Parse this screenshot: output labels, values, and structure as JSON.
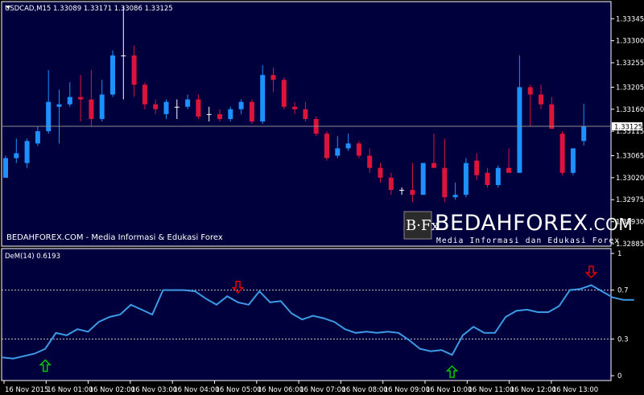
{
  "colors": {
    "background": "#000000",
    "panel": "#00003c",
    "frame": "#ffffff",
    "bull": "#1e90ff",
    "bear": "#dc143c",
    "doji": "#ffffff",
    "indicator_line": "#3c9be6",
    "up_arrow": "#00c800",
    "down_arrow": "#e60000"
  },
  "chart_data": [
    {
      "type": "candlestick",
      "title": "USDCAD,M15  1.33089 1.33171 1.33086 1.33125",
      "symbol": "USDCAD,M15",
      "ohlc_header": "1.33089 1.33171 1.33086 1.33125",
      "ylim": [
        1.3288,
        1.3338
      ],
      "yticks": [
        "1.33345",
        "1.33300",
        "1.33255",
        "1.33205",
        "1.33160",
        "1.33115",
        "1.33065",
        "1.33020",
        "1.32975",
        "1.32930",
        "1.32885"
      ],
      "ytick_values": [
        1.33345,
        1.333,
        1.33255,
        1.33205,
        1.3316,
        1.33115,
        1.33065,
        1.3302,
        1.32975,
        1.3293,
        1.32885
      ],
      "current_price_label": "1.33125",
      "current_price": 1.33125,
      "candles": [
        {
          "o": 1.3302,
          "h": 1.33065,
          "l": 1.3302,
          "c": 1.3306
        },
        {
          "o": 1.3306,
          "h": 1.331,
          "l": 1.3305,
          "c": 1.3307
        },
        {
          "o": 1.3305,
          "h": 1.331,
          "l": 1.3304,
          "c": 1.33095
        },
        {
          "o": 1.3309,
          "h": 1.33125,
          "l": 1.33085,
          "c": 1.33115
        },
        {
          "o": 1.33115,
          "h": 1.3324,
          "l": 1.3311,
          "c": 1.33175
        },
        {
          "o": 1.33165,
          "h": 1.332,
          "l": 1.3309,
          "c": 1.3317
        },
        {
          "o": 1.3317,
          "h": 1.33215,
          "l": 1.33165,
          "c": 1.33185
        },
        {
          "o": 1.33185,
          "h": 1.3323,
          "l": 1.33135,
          "c": 1.3318
        },
        {
          "o": 1.3318,
          "h": 1.3324,
          "l": 1.33125,
          "c": 1.3314
        },
        {
          "o": 1.3314,
          "h": 1.3322,
          "l": 1.33135,
          "c": 1.3319
        },
        {
          "o": 1.3319,
          "h": 1.3328,
          "l": 1.33185,
          "c": 1.3327
        },
        {
          "o": 1.3327,
          "h": 1.3337,
          "l": 1.3318,
          "c": 1.3327
        },
        {
          "o": 1.3327,
          "h": 1.3329,
          "l": 1.33185,
          "c": 1.3321
        },
        {
          "o": 1.3321,
          "h": 1.33215,
          "l": 1.3316,
          "c": 1.3317
        },
        {
          "o": 1.3317,
          "h": 1.3318,
          "l": 1.3315,
          "c": 1.3316
        },
        {
          "o": 1.3315,
          "h": 1.3318,
          "l": 1.3314,
          "c": 1.33175
        },
        {
          "o": 1.33165,
          "h": 1.3318,
          "l": 1.3314,
          "c": 1.33165
        },
        {
          "o": 1.33165,
          "h": 1.3319,
          "l": 1.3316,
          "c": 1.3318
        },
        {
          "o": 1.3318,
          "h": 1.3319,
          "l": 1.3314,
          "c": 1.33145
        },
        {
          "o": 1.3315,
          "h": 1.33165,
          "l": 1.33135,
          "c": 1.3315
        },
        {
          "o": 1.3315,
          "h": 1.3316,
          "l": 1.33135,
          "c": 1.3314
        },
        {
          "o": 1.3314,
          "h": 1.33165,
          "l": 1.33135,
          "c": 1.3316
        },
        {
          "o": 1.3316,
          "h": 1.3318,
          "l": 1.3315,
          "c": 1.33175
        },
        {
          "o": 1.33175,
          "h": 1.3318,
          "l": 1.3313,
          "c": 1.33135
        },
        {
          "o": 1.33135,
          "h": 1.3325,
          "l": 1.3313,
          "c": 1.3323
        },
        {
          "o": 1.3323,
          "h": 1.33245,
          "l": 1.33195,
          "c": 1.3322
        },
        {
          "o": 1.3322,
          "h": 1.33225,
          "l": 1.3316,
          "c": 1.33165
        },
        {
          "o": 1.33165,
          "h": 1.33175,
          "l": 1.3315,
          "c": 1.3316
        },
        {
          "o": 1.3316,
          "h": 1.33175,
          "l": 1.33135,
          "c": 1.3314
        },
        {
          "o": 1.3314,
          "h": 1.33145,
          "l": 1.33105,
          "c": 1.3311
        },
        {
          "o": 1.3311,
          "h": 1.33115,
          "l": 1.33055,
          "c": 1.3306
        },
        {
          "o": 1.33065,
          "h": 1.33105,
          "l": 1.3306,
          "c": 1.3308
        },
        {
          "o": 1.3308,
          "h": 1.3311,
          "l": 1.33075,
          "c": 1.3309
        },
        {
          "o": 1.3309,
          "h": 1.33095,
          "l": 1.3306,
          "c": 1.33065
        },
        {
          "o": 1.33065,
          "h": 1.3308,
          "l": 1.3303,
          "c": 1.3304
        },
        {
          "o": 1.3304,
          "h": 1.3305,
          "l": 1.3301,
          "c": 1.3302
        },
        {
          "o": 1.3302,
          "h": 1.3303,
          "l": 1.32985,
          "c": 1.32995
        },
        {
          "o": 1.32995,
          "h": 1.33,
          "l": 1.32985,
          "c": 1.32995
        },
        {
          "o": 1.32995,
          "h": 1.3305,
          "l": 1.3297,
          "c": 1.32985
        },
        {
          "o": 1.32985,
          "h": 1.3305,
          "l": 1.32985,
          "c": 1.3305
        },
        {
          "o": 1.3305,
          "h": 1.3311,
          "l": 1.3304,
          "c": 1.3304
        },
        {
          "o": 1.3304,
          "h": 1.331,
          "l": 1.3297,
          "c": 1.3298
        },
        {
          "o": 1.3298,
          "h": 1.3301,
          "l": 1.32975,
          "c": 1.32985
        },
        {
          "o": 1.32985,
          "h": 1.3306,
          "l": 1.3298,
          "c": 1.3305
        },
        {
          "o": 1.33055,
          "h": 1.3307,
          "l": 1.33015,
          "c": 1.33025
        },
        {
          "o": 1.3303,
          "h": 1.3304,
          "l": 1.33,
          "c": 1.33005
        },
        {
          "o": 1.33005,
          "h": 1.33045,
          "l": 1.33,
          "c": 1.3304
        },
        {
          "o": 1.3304,
          "h": 1.3308,
          "l": 1.3303,
          "c": 1.3303
        },
        {
          "o": 1.3303,
          "h": 1.3327,
          "l": 1.3303,
          "c": 1.33205
        },
        {
          "o": 1.33205,
          "h": 1.3321,
          "l": 1.33125,
          "c": 1.3319
        },
        {
          "o": 1.3319,
          "h": 1.3321,
          "l": 1.3316,
          "c": 1.3317
        },
        {
          "o": 1.3317,
          "h": 1.33185,
          "l": 1.3312,
          "c": 1.3312
        },
        {
          "o": 1.3311,
          "h": 1.33115,
          "l": 1.33025,
          "c": 1.3303
        },
        {
          "o": 1.3303,
          "h": 1.3308,
          "l": 1.33025,
          "c": 1.3308
        },
        {
          "o": 1.33095,
          "h": 1.33171,
          "l": 1.33086,
          "c": 1.33125
        }
      ]
    },
    {
      "type": "line",
      "title": "DeM(14) 0.6193",
      "indicator_name": "DeM(14) 0.6193",
      "ylim": [
        0,
        1
      ],
      "yticks": [
        "1",
        "0.7",
        "0.3",
        "0"
      ],
      "ytick_values": [
        1,
        0.7,
        0.3,
        0
      ],
      "levels": [
        0.7,
        0.3
      ],
      "values": [
        0.15,
        0.14,
        0.16,
        0.18,
        0.22,
        0.35,
        0.33,
        0.38,
        0.36,
        0.44,
        0.48,
        0.5,
        0.58,
        0.54,
        0.5,
        0.7,
        0.7,
        0.7,
        0.69,
        0.63,
        0.58,
        0.65,
        0.6,
        0.58,
        0.69,
        0.6,
        0.61,
        0.51,
        0.46,
        0.49,
        0.47,
        0.44,
        0.38,
        0.35,
        0.36,
        0.35,
        0.36,
        0.35,
        0.29,
        0.22,
        0.2,
        0.21,
        0.17,
        0.33,
        0.4,
        0.35,
        0.35,
        0.48,
        0.53,
        0.54,
        0.52,
        0.52,
        0.57,
        0.7,
        0.71,
        0.74,
        0.69,
        0.64,
        0.62,
        0.62
      ],
      "signals": [
        {
          "type": "up",
          "index": 4
        },
        {
          "type": "down",
          "index": 22
        },
        {
          "type": "up",
          "index": 42
        },
        {
          "type": "down",
          "index": 55
        }
      ]
    }
  ],
  "xaxis": {
    "labels": [
      "16 Nov 2015",
      "16 Nov 01:00",
      "16 Nov 02:00",
      "16 Nov 03:00",
      "16 Nov 04:00",
      "16 Nov 05:00",
      "16 Nov 06:00",
      "16 Nov 07:00",
      "16 Nov 08:00",
      "16 Nov 09:00",
      "16 Nov 10:00",
      "16 Nov 11:00",
      "16 Nov 12:00",
      "16 Nov 13:00"
    ]
  },
  "watermark": {
    "logo_text": "B·Fx",
    "brand": "BEDAHFOREX",
    "domain_suffix": ".COM",
    "tagline": "Media Informasi dan Edukasi Forex"
  },
  "site_label": "BEDAHFOREX.COM - Media Informasi & Edukasi Forex"
}
